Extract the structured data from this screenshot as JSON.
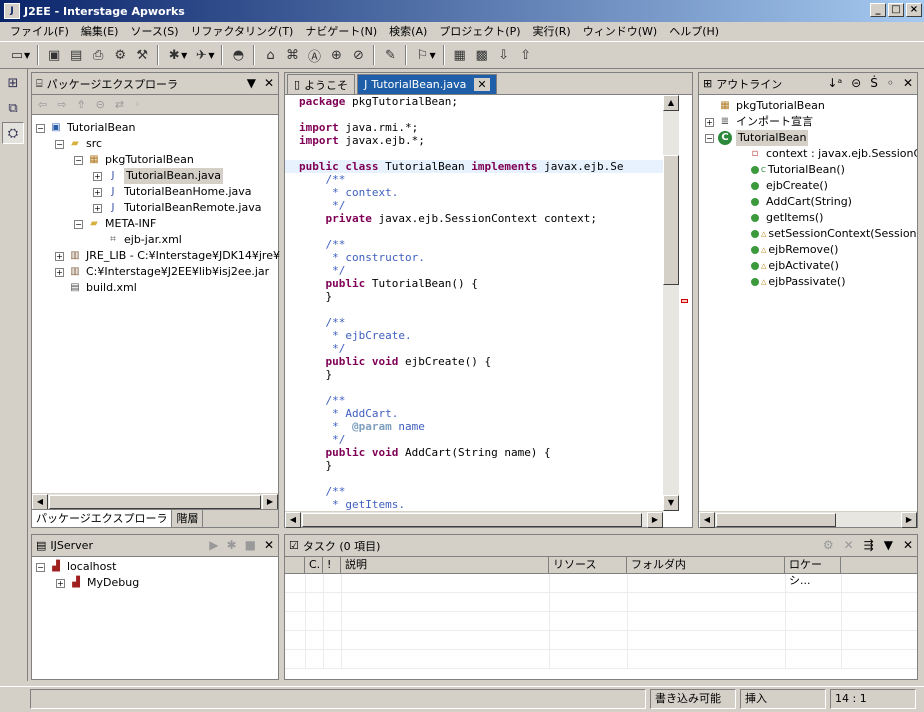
{
  "window": {
    "title": "J2EE - Interstage Apworks"
  },
  "menu": [
    "ファイル(F)",
    "編集(E)",
    "ソース(S)",
    "リファクタリング(T)",
    "ナビゲート(N)",
    "検索(A)",
    "プロジェクト(P)",
    "実行(R)",
    "ウィンドウ(W)",
    "ヘルプ(H)"
  ],
  "package_explorer": {
    "title": "パッケージエクスプローラ",
    "tree": [
      {
        "label": "TutorialBean",
        "indent": 0,
        "exp": "−",
        "icon": "project"
      },
      {
        "label": "src",
        "indent": 1,
        "exp": "−",
        "icon": "folder"
      },
      {
        "label": "pkgTutorialBean",
        "indent": 2,
        "exp": "−",
        "icon": "package"
      },
      {
        "label": "TutorialBean.java",
        "indent": 3,
        "exp": "+",
        "icon": "java",
        "selected": true
      },
      {
        "label": "TutorialBeanHome.java",
        "indent": 3,
        "exp": "+",
        "icon": "java"
      },
      {
        "label": "TutorialBeanRemote.java",
        "indent": 3,
        "exp": "+",
        "icon": "java"
      },
      {
        "label": "META-INF",
        "indent": 2,
        "exp": "−",
        "icon": "folder"
      },
      {
        "label": "ejb-jar.xml",
        "indent": 3,
        "exp": "",
        "icon": "xml"
      },
      {
        "label": "JRE_LIB - C:¥Interstage¥JDK14¥jre¥",
        "indent": 1,
        "exp": "+",
        "icon": "jar"
      },
      {
        "label": "C:¥Interstage¥J2EE¥lib¥isj2ee.jar",
        "indent": 1,
        "exp": "+",
        "icon": "jar"
      },
      {
        "label": "build.xml",
        "indent": 1,
        "exp": "",
        "icon": "file"
      }
    ],
    "tabs": [
      "パッケージエクスプローラ",
      "階層"
    ]
  },
  "editor": {
    "tabs": [
      "ようこそ",
      "TutorialBean.java"
    ],
    "lines": [
      [
        [
          "kw",
          "package"
        ],
        [
          "",
          "pkgTutorialBean;"
        ]
      ],
      [
        [
          "",
          ""
        ]
      ],
      [
        [
          "kw",
          "import"
        ],
        [
          "",
          "java.rmi.*;"
        ]
      ],
      [
        [
          "kw",
          "import"
        ],
        [
          "",
          "javax.ejb.*;"
        ]
      ],
      [
        [
          "",
          ""
        ]
      ],
      [
        [
          "kw",
          "public"
        ],
        [
          "kw",
          "class"
        ],
        [
          "",
          "TutorialBean"
        ],
        [
          "kw",
          "implements"
        ],
        [
          "",
          "javax.ejb.Se"
        ]
      ],
      [
        [
          "cm",
          "    /**"
        ]
      ],
      [
        [
          "cm",
          "     * context."
        ]
      ],
      [
        [
          "cm",
          "     */"
        ]
      ],
      [
        [
          "kw",
          "    private"
        ],
        [
          "",
          "javax.ejb.SessionContext context;"
        ]
      ],
      [
        [
          "",
          ""
        ]
      ],
      [
        [
          "cm",
          "    /**"
        ]
      ],
      [
        [
          "cm",
          "     * constructor."
        ]
      ],
      [
        [
          "cm",
          "     */"
        ]
      ],
      [
        [
          "kw",
          "    public"
        ],
        [
          "",
          "TutorialBean() {"
        ]
      ],
      [
        [
          "",
          "    }"
        ]
      ],
      [
        [
          "",
          ""
        ]
      ],
      [
        [
          "cm",
          "    /**"
        ]
      ],
      [
        [
          "cm",
          "     * ejbCreate."
        ]
      ],
      [
        [
          "cm",
          "     */"
        ]
      ],
      [
        [
          "kw",
          "    public"
        ],
        [
          "kw",
          "void"
        ],
        [
          "",
          "ejbCreate() {"
        ]
      ],
      [
        [
          "",
          "    }"
        ]
      ],
      [
        [
          "",
          ""
        ]
      ],
      [
        [
          "cm",
          "    /**"
        ]
      ],
      [
        [
          "cm",
          "     * AddCart."
        ]
      ],
      [
        [
          "cm",
          "     * "
        ],
        [
          "cmb",
          "@param"
        ],
        [
          "cm",
          "name"
        ]
      ],
      [
        [
          "cm",
          "     */"
        ]
      ],
      [
        [
          "kw",
          "    public"
        ],
        [
          "kw",
          "void"
        ],
        [
          "",
          "AddCart(String name) {"
        ]
      ],
      [
        [
          "",
          "    }"
        ]
      ],
      [
        [
          "",
          ""
        ]
      ],
      [
        [
          "cm",
          "    /**"
        ]
      ],
      [
        [
          "cm",
          "     * getItems."
        ]
      ]
    ]
  },
  "outline": {
    "title": "アウトライン",
    "tree": [
      {
        "label": "pkgTutorialBean",
        "indent": 0,
        "exp": "",
        "icon": "package"
      },
      {
        "label": "インポート宣言",
        "indent": 0,
        "exp": "+",
        "icon": "imports"
      },
      {
        "label": "TutorialBean",
        "indent": 0,
        "exp": "−",
        "icon": "class",
        "selected": true
      },
      {
        "label": "context : javax.ejb.SessionC",
        "indent": 1,
        "exp": "",
        "icon": "field"
      },
      {
        "label": "TutorialBean()",
        "indent": 1,
        "exp": "",
        "icon": "method",
        "mark": "C"
      },
      {
        "label": "ejbCreate()",
        "indent": 1,
        "exp": "",
        "icon": "method"
      },
      {
        "label": "AddCart(String)",
        "indent": 1,
        "exp": "",
        "icon": "method"
      },
      {
        "label": "getItems()",
        "indent": 1,
        "exp": "",
        "icon": "method"
      },
      {
        "label": "setSessionContext(Session",
        "indent": 1,
        "exp": "",
        "icon": "method",
        "mark": "△"
      },
      {
        "label": "ejbRemove()",
        "indent": 1,
        "exp": "",
        "icon": "method",
        "mark": "△"
      },
      {
        "label": "ejbActivate()",
        "indent": 1,
        "exp": "",
        "icon": "method",
        "mark": "△"
      },
      {
        "label": "ejbPassivate()",
        "indent": 1,
        "exp": "",
        "icon": "method",
        "mark": "△"
      }
    ]
  },
  "server": {
    "title": "IJServer",
    "tree": [
      {
        "label": "localhost",
        "indent": 0,
        "exp": "−",
        "icon": "server"
      },
      {
        "label": "MyDebug",
        "indent": 1,
        "exp": "+",
        "icon": "server"
      }
    ]
  },
  "tasks": {
    "title": "タスク (0 項目)",
    "columns": [
      "C.",
      "!",
      "説明",
      "リソース",
      "フォルダ内",
      "ロケーシ..."
    ]
  },
  "status": {
    "mode": "書き込み可能",
    "insert": "挿入",
    "pos": "14 : 1"
  }
}
